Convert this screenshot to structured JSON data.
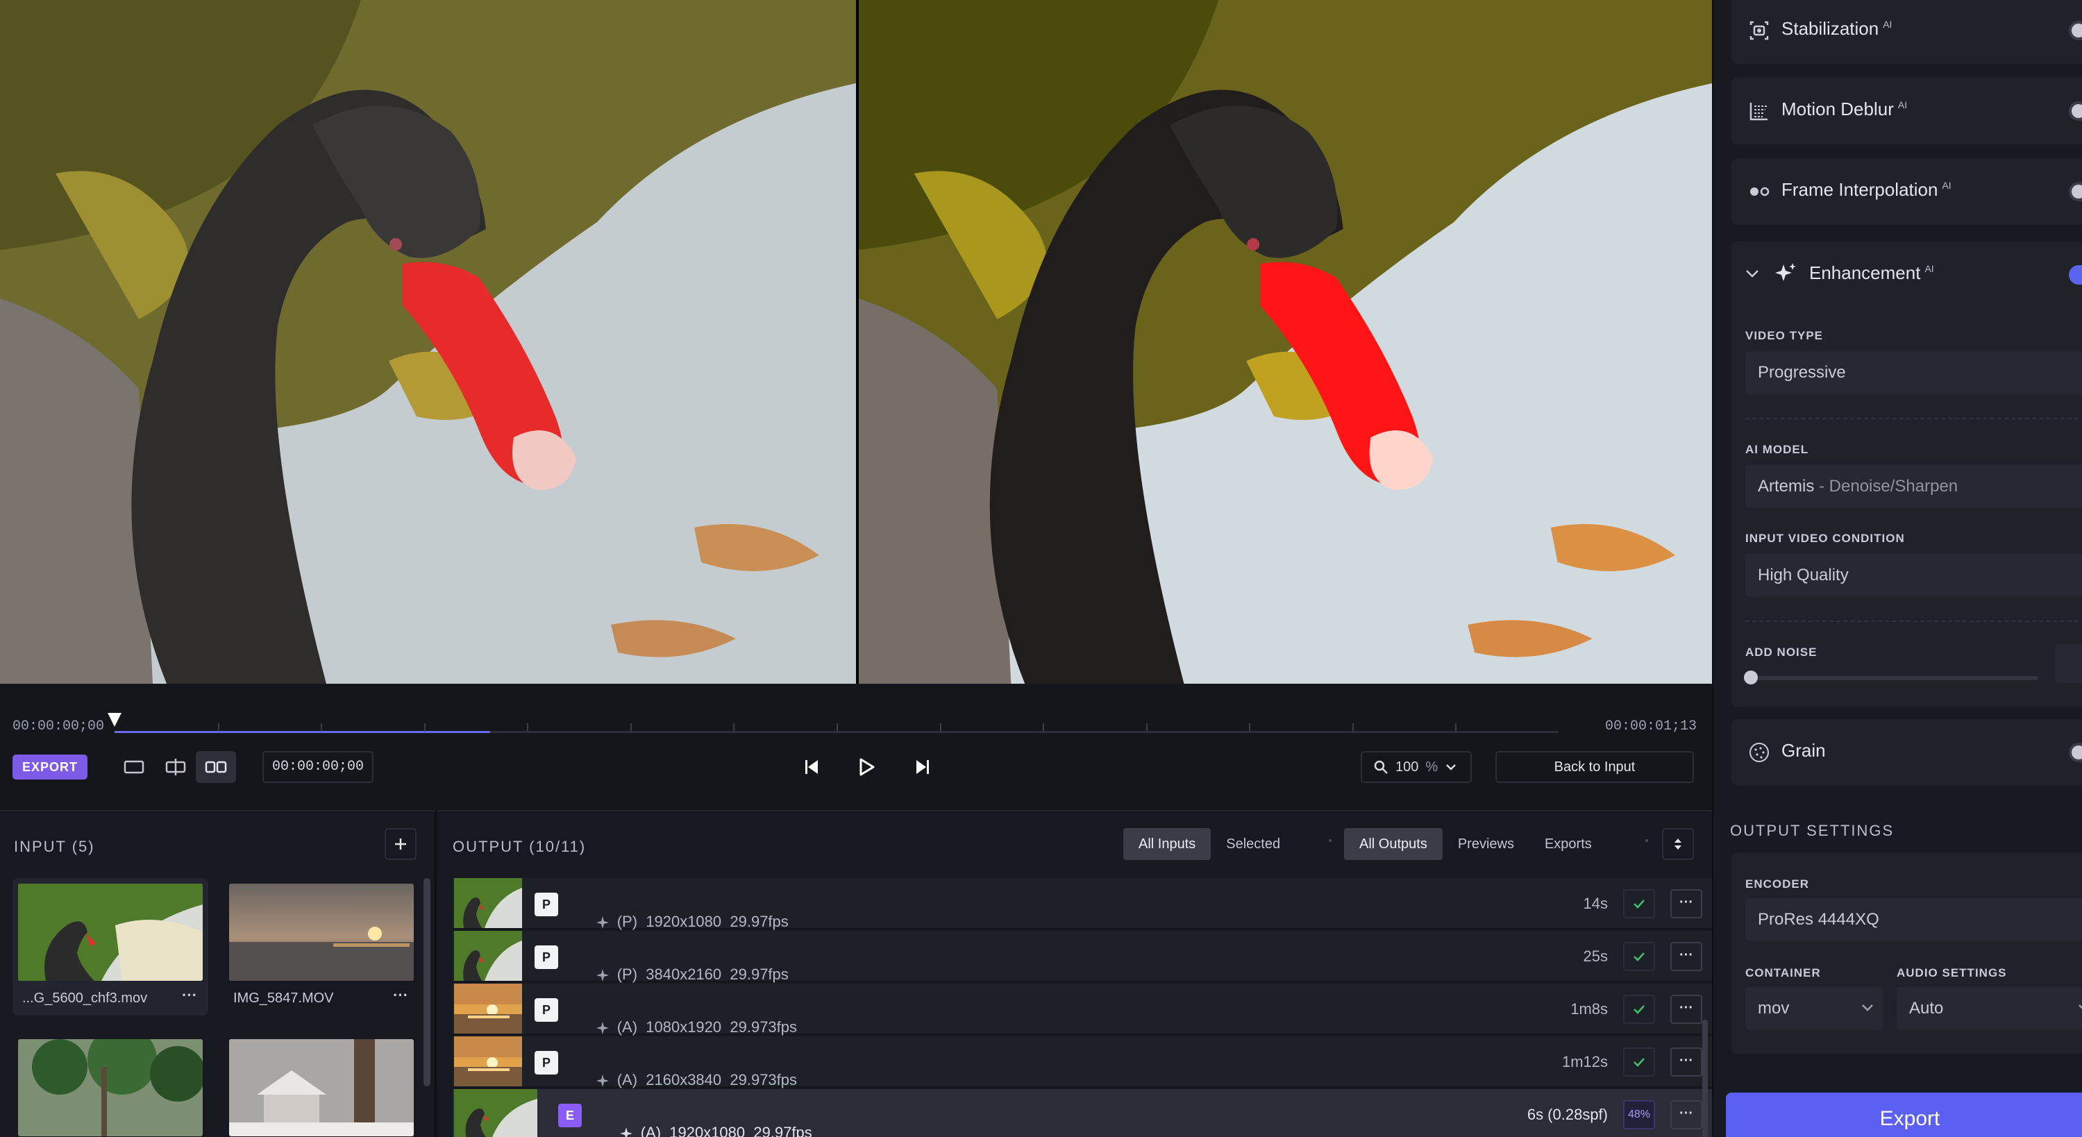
{
  "timeline": {
    "start_timecode": "00:00:00;00",
    "end_timecode": "00:00:01;13",
    "played_fraction": 0.26
  },
  "controls": {
    "export_badge": "EXPORT",
    "current_timecode": "00:00:00;00",
    "zoom_value": "100",
    "zoom_unit": "%",
    "back_label": "Back to Input"
  },
  "input_panel": {
    "title": "INPUT (5)",
    "files": [
      {
        "name": "...G_5600_chf3.mov"
      },
      {
        "name": "IMG_5847.MOV"
      }
    ]
  },
  "output_panel": {
    "title": "OUTPUT (10/11)",
    "filters_a": [
      "All Inputs",
      "Selected"
    ],
    "filters_b": [
      "All Outputs",
      "Previews",
      "Exports"
    ],
    "rows": [
      {
        "badge": "P",
        "mode": "(P)",
        "res": "1920x1080",
        "fps": "29.97fps",
        "time": "14s",
        "status": "done"
      },
      {
        "badge": "P",
        "mode": "(P)",
        "res": "3840x2160",
        "fps": "29.97fps",
        "time": "25s",
        "status": "done"
      },
      {
        "badge": "P",
        "mode": "(A)",
        "res": "1080x1920",
        "fps": "29.973fps",
        "time": "1m8s",
        "status": "done"
      },
      {
        "badge": "P",
        "mode": "(A)",
        "res": "2160x3840",
        "fps": "29.973fps",
        "time": "1m12s",
        "status": "done"
      },
      {
        "badge": "E",
        "mode": "(A)",
        "res": "1920x1080",
        "fps": "29.97fps",
        "time": "6s (0.28spf)",
        "status": "48%"
      }
    ]
  },
  "sidebar": {
    "ai_tag": "AI",
    "filters": [
      {
        "label": "Stabilization",
        "on": false
      },
      {
        "label": "Motion Deblur",
        "on": false
      },
      {
        "label": "Frame Interpolation",
        "on": false
      }
    ],
    "enhancement": {
      "label": "Enhancement",
      "on": true,
      "video_type_label": "VIDEO TYPE",
      "video_type": "Progressive",
      "ai_model_label": "AI MODEL",
      "ai_model": "Artemis",
      "ai_model_sub": " - Denoise/Sharpen",
      "condition_label": "INPUT VIDEO CONDITION",
      "condition": "High Quality",
      "add_noise_label": "ADD NOISE",
      "add_noise_value": 0
    },
    "grain": {
      "label": "Grain",
      "on": false
    },
    "output_settings": {
      "title": "OUTPUT SETTINGS",
      "encoder_label": "ENCODER",
      "encoder": "ProRes 4444XQ",
      "container_label": "CONTAINER",
      "container": "mov",
      "audio_label": "AUDIO SETTINGS",
      "audio": "Auto"
    },
    "export_label": "Export"
  },
  "colors": {
    "accent": "#5b5ff2",
    "export_badge": "#7c5ce6",
    "check": "#3fbf6b",
    "bg": "#12141a"
  }
}
